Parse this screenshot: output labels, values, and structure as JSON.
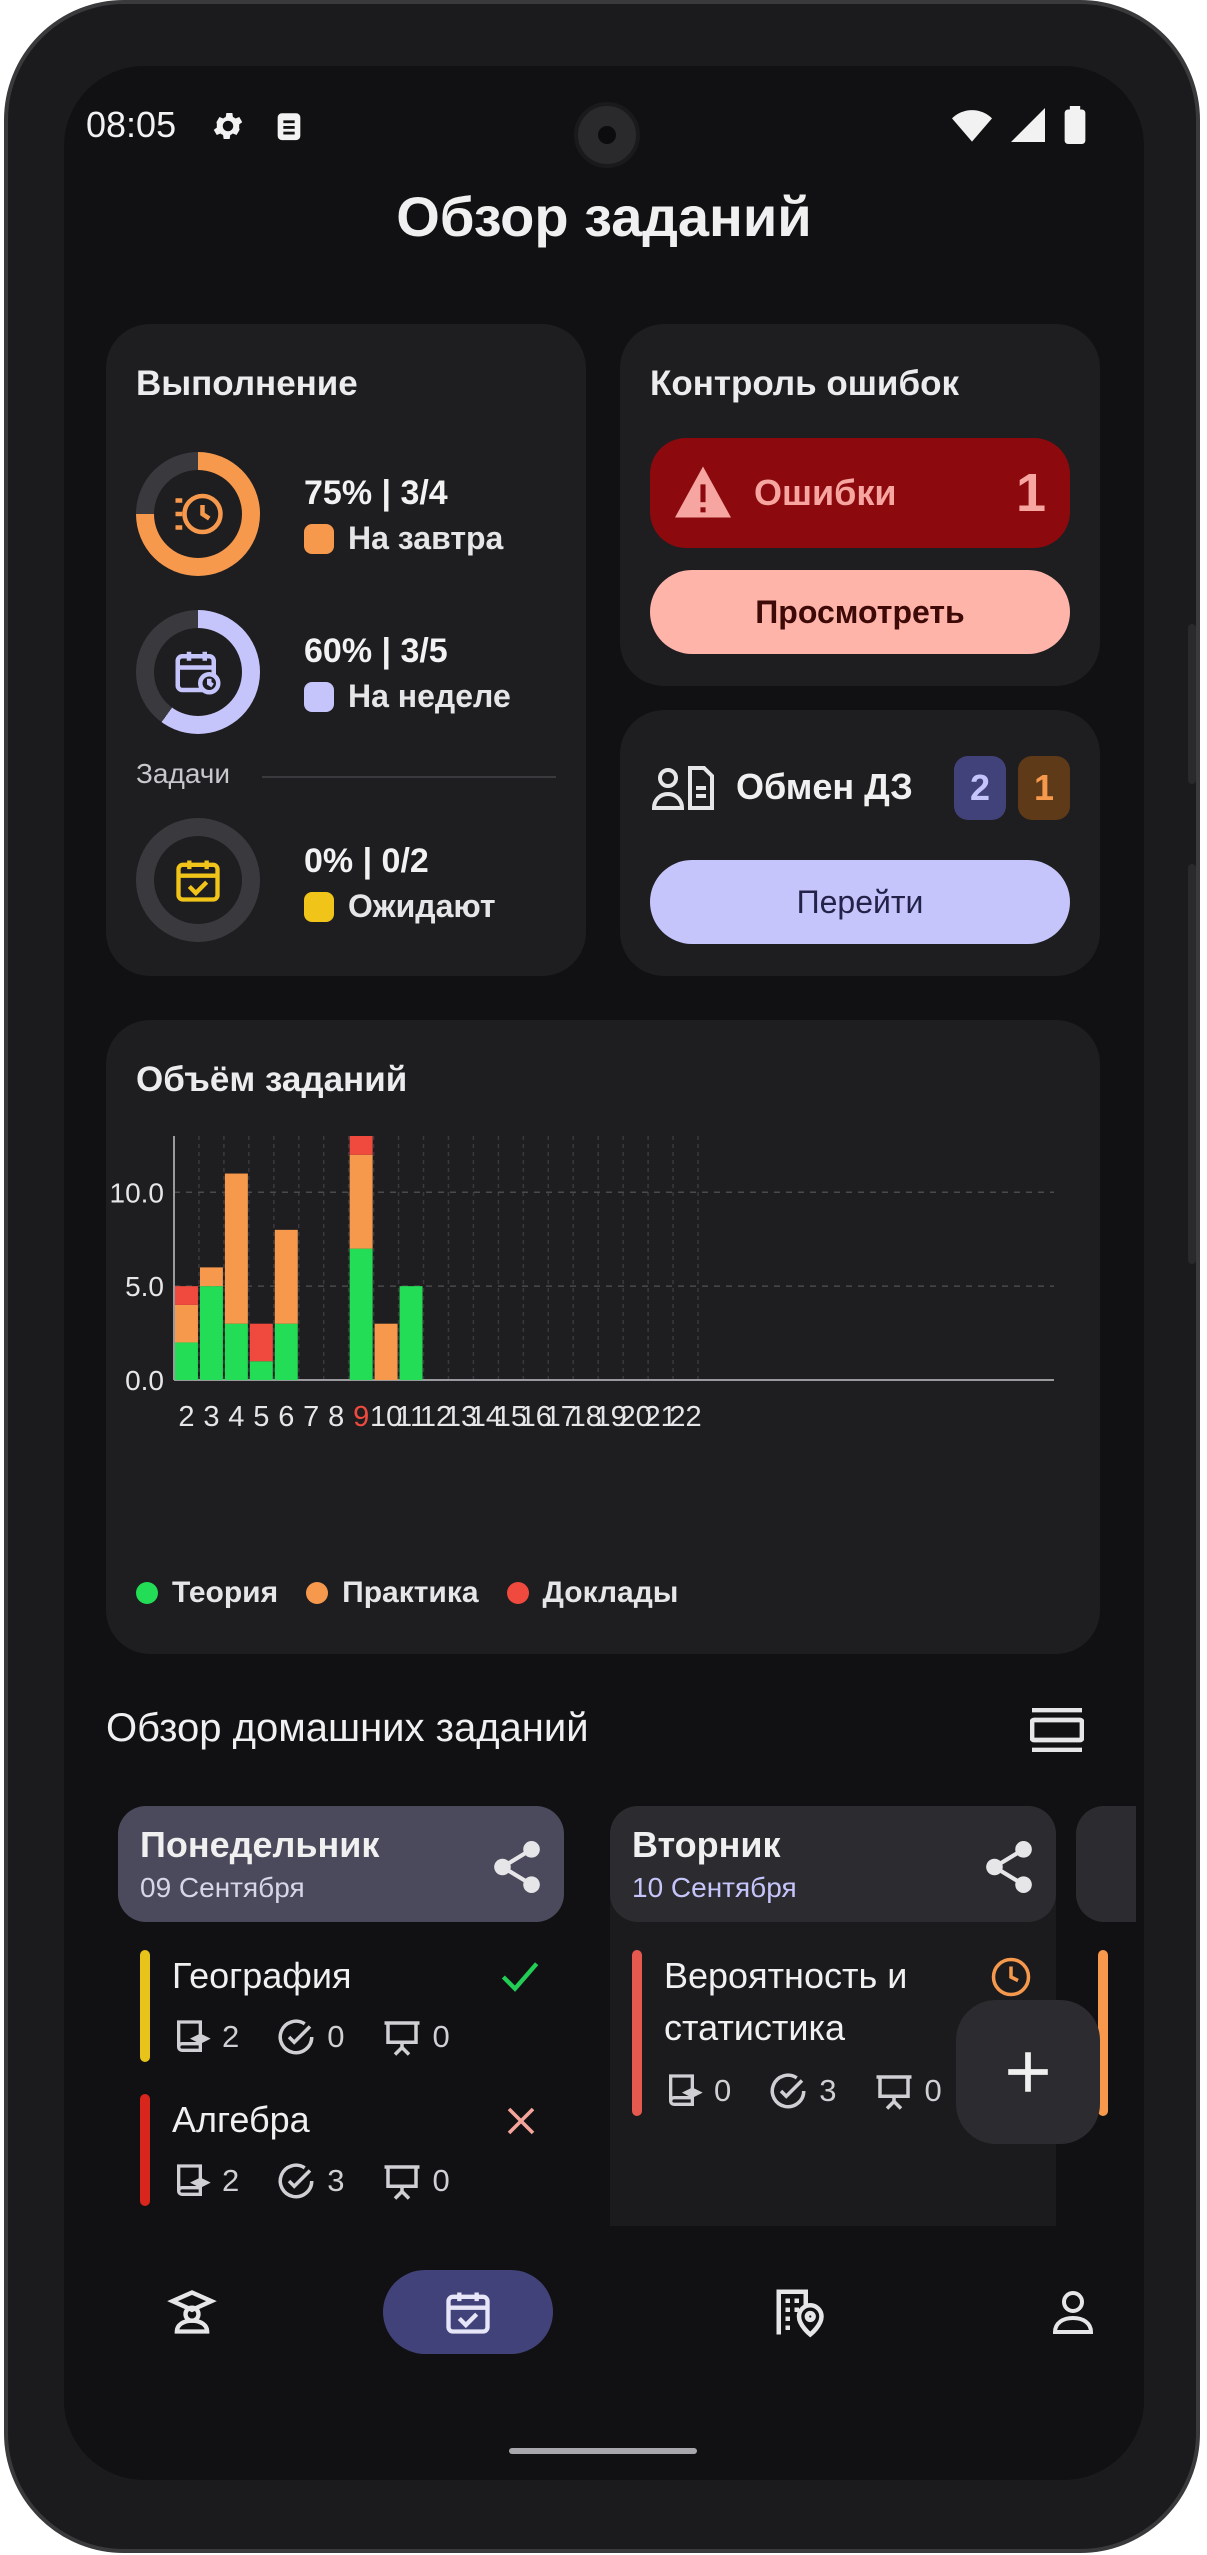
{
  "status_bar": {
    "time": "08:05"
  },
  "page": {
    "title": "Обзор заданий"
  },
  "completion": {
    "title": "Выполнение",
    "items": [
      {
        "value": "75% | 3/4",
        "label": "На завтра",
        "progress": 0.75,
        "color": "#f7994d"
      },
      {
        "value": "60% | 3/5",
        "label": "На неделе",
        "progress": 0.6,
        "color": "#c5c5fb"
      }
    ],
    "tasks_label": "Задачи",
    "tasks": {
      "value": "0% | 0/2",
      "label": "Ожидают",
      "progress": 0,
      "color": "#f0c419"
    }
  },
  "errors": {
    "title": "Контроль ошибок",
    "label": "Ошибки",
    "count": "1",
    "view_button": "Просмотреть"
  },
  "exchange": {
    "title": "Обмен ДЗ",
    "badge_a": "2",
    "badge_b": "1",
    "go_button": "Перейти"
  },
  "chart": {
    "title": "Объём заданий",
    "legend": [
      {
        "name": "Теория",
        "color": "#22dd55"
      },
      {
        "name": "Практика",
        "color": "#f7994d"
      },
      {
        "name": "Доклады",
        "color": "#f04a3e"
      }
    ]
  },
  "chart_data": {
    "type": "bar",
    "stacked": true,
    "title": "Объём заданий",
    "categories": [
      "2",
      "3",
      "4",
      "5",
      "6",
      "7",
      "8",
      "9",
      "10",
      "11",
      "12",
      "13",
      "14",
      "15",
      "16",
      "17",
      "18",
      "19",
      "20",
      "21",
      "22"
    ],
    "highlighted_category": "9",
    "series": [
      {
        "name": "Теория",
        "color": "#22dd55",
        "values": [
          2,
          5,
          3,
          1,
          3,
          0,
          0,
          7,
          0,
          5,
          0,
          0,
          0,
          0,
          0,
          0,
          0,
          0,
          0,
          0,
          0
        ]
      },
      {
        "name": "Практика",
        "color": "#f7994d",
        "values": [
          2,
          1,
          8,
          0,
          5,
          0,
          0,
          5,
          3,
          0,
          0,
          0,
          0,
          0,
          0,
          0,
          0,
          0,
          0,
          0,
          0
        ]
      },
      {
        "name": "Доклады",
        "color": "#f04a3e",
        "values": [
          1,
          0,
          0,
          2,
          0,
          0,
          0,
          1,
          0,
          0,
          0,
          0,
          0,
          0,
          0,
          0,
          0,
          0,
          0,
          0,
          0
        ]
      }
    ],
    "yticks": [
      "0.0",
      "5.0",
      "10.0"
    ],
    "ylim": [
      0,
      13
    ],
    "grid": true,
    "legend_position": "bottom"
  },
  "homework": {
    "title": "Обзор домашних заданий",
    "days": [
      {
        "name": "Понедельник",
        "date": "09 Сентября",
        "items": [
          {
            "title": "География",
            "color": "#e8c31a",
            "status": "done",
            "a": "2",
            "b": "0",
            "c": "0"
          },
          {
            "title": "Алгебра",
            "color": "#d9261c",
            "status": "cancelled",
            "a": "2",
            "b": "3",
            "c": "0"
          }
        ]
      },
      {
        "name": "Вторник",
        "date": "10 Сентября",
        "items": [
          {
            "title": "Вероятность и статистика",
            "color": "#e5594e",
            "status": "pending",
            "a": "0",
            "b": "3",
            "c": "0"
          }
        ]
      }
    ]
  },
  "nav": {
    "items": [
      "study-icon",
      "calendar-check-icon",
      "building-map-icon",
      "person-icon"
    ],
    "active": 1
  }
}
